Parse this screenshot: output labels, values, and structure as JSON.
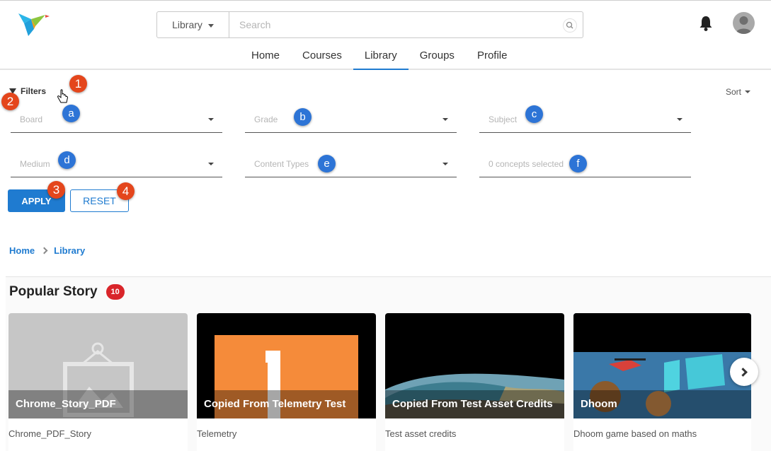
{
  "header": {
    "scope_label": "Library",
    "search_placeholder": "Search",
    "nav_tabs": [
      "Home",
      "Courses",
      "Library",
      "Groups",
      "Profile"
    ],
    "active_tab": "Library"
  },
  "filters": {
    "toggle_label": "Filters",
    "sort_label": "Sort",
    "fields": {
      "board": "Board",
      "grade": "Grade",
      "subject": "Subject",
      "medium": "Medium",
      "content_types": "Content Types",
      "concepts": "0 concepts selected"
    },
    "apply_label": "APPLY",
    "reset_label": "RESET"
  },
  "markers": {
    "m1": "1",
    "m2": "2",
    "m3": "3",
    "m4": "4",
    "ma": "a",
    "mb": "b",
    "mc": "c",
    "md": "d",
    "me": "e",
    "mf": "f"
  },
  "breadcrumb": [
    "Home",
    "Library"
  ],
  "section": {
    "title": "Popular Story",
    "count": "10",
    "cards": [
      {
        "title": "Chrome_Story_PDF",
        "desc": "Chrome_PDF_Story"
      },
      {
        "title": "Copied From Telemetry Test",
        "desc": "Telemetry"
      },
      {
        "title": "Copied From Test Asset Credits",
        "desc": "Test asset credits"
      },
      {
        "title": "Dhoom",
        "desc": "Dhoom game based on maths"
      }
    ]
  },
  "colors": {
    "accent": "#1f7bd0",
    "marker_red": "#e4461c",
    "marker_blue": "#2d74d6",
    "badge": "#d9252a"
  },
  "icons": [
    "logo-bird-icon",
    "search-icon",
    "bell-icon",
    "avatar-icon",
    "filter-icon",
    "chevron-right-icon"
  ]
}
